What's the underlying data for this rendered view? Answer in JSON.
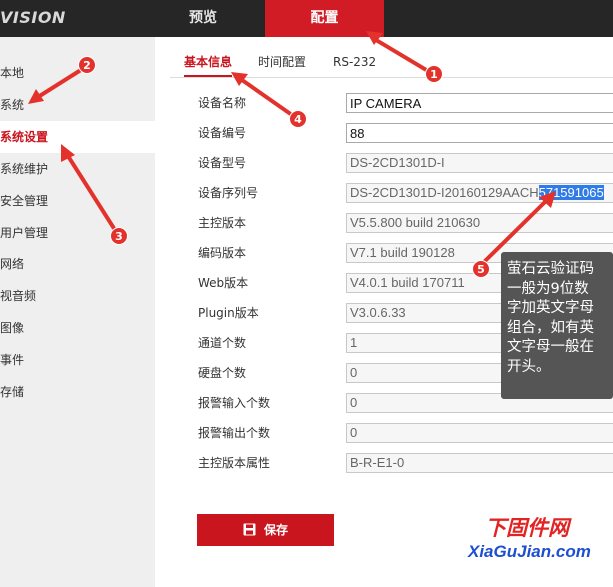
{
  "header": {
    "brand": "VISION",
    "nav": [
      "预览",
      "配置"
    ],
    "active_nav": "配置"
  },
  "sidebar": {
    "items": [
      {
        "label": "本地"
      },
      {
        "label": "系统"
      },
      {
        "label": "系统设置",
        "active": true
      },
      {
        "label": "系统维护"
      },
      {
        "label": "安全管理"
      },
      {
        "label": "用户管理"
      },
      {
        "label": "网络"
      },
      {
        "label": "视音频"
      },
      {
        "label": "图像"
      },
      {
        "label": "事件"
      },
      {
        "label": "存储"
      }
    ]
  },
  "tabs": [
    {
      "label": "基本信息",
      "active": true
    },
    {
      "label": "时间配置"
    },
    {
      "label": "RS-232"
    }
  ],
  "form": {
    "rows": [
      {
        "label": "设备名称",
        "value": "IP CAMERA"
      },
      {
        "label": "设备编号",
        "value": "88"
      },
      {
        "label": "设备型号",
        "value": "DS-2CD1301D-I"
      },
      {
        "label": "设备序列号",
        "value_prefix": "DS-2CD1301D-I20160129AACH",
        "value_selected": "571591065"
      },
      {
        "label": "主控版本",
        "value": "V5.5.800 build 210630"
      },
      {
        "label": "编码版本",
        "value": "V7.1 build 190128"
      },
      {
        "label": "Web版本",
        "value": "V4.0.1 build 170711"
      },
      {
        "label": "Plugin版本",
        "value": "V3.0.6.33"
      },
      {
        "label": "通道个数",
        "value": "1"
      },
      {
        "label": "硬盘个数",
        "value": "0"
      },
      {
        "label": "报警输入个数",
        "value": "0"
      },
      {
        "label": "报警输出个数",
        "value": "0"
      },
      {
        "label": "主控版本属性",
        "value": "B-R-E1-0"
      }
    ],
    "save_label": "保存"
  },
  "annotations": {
    "badges": [
      "1",
      "2",
      "3",
      "4",
      "5"
    ],
    "callout_lines": [
      "萤石云验证码",
      "一般为9位数",
      "字加英文字母",
      "组合，如有英",
      "文字母一般在",
      "开头。"
    ],
    "color": "#e3322b"
  },
  "watermark": {
    "cn": "下固件网",
    "en": "XiaGuJian.com"
  },
  "colors": {
    "accent": "#c9151e",
    "topbar": "#262626",
    "sidebar": "#efefef",
    "selection": "#2f7ce8"
  }
}
